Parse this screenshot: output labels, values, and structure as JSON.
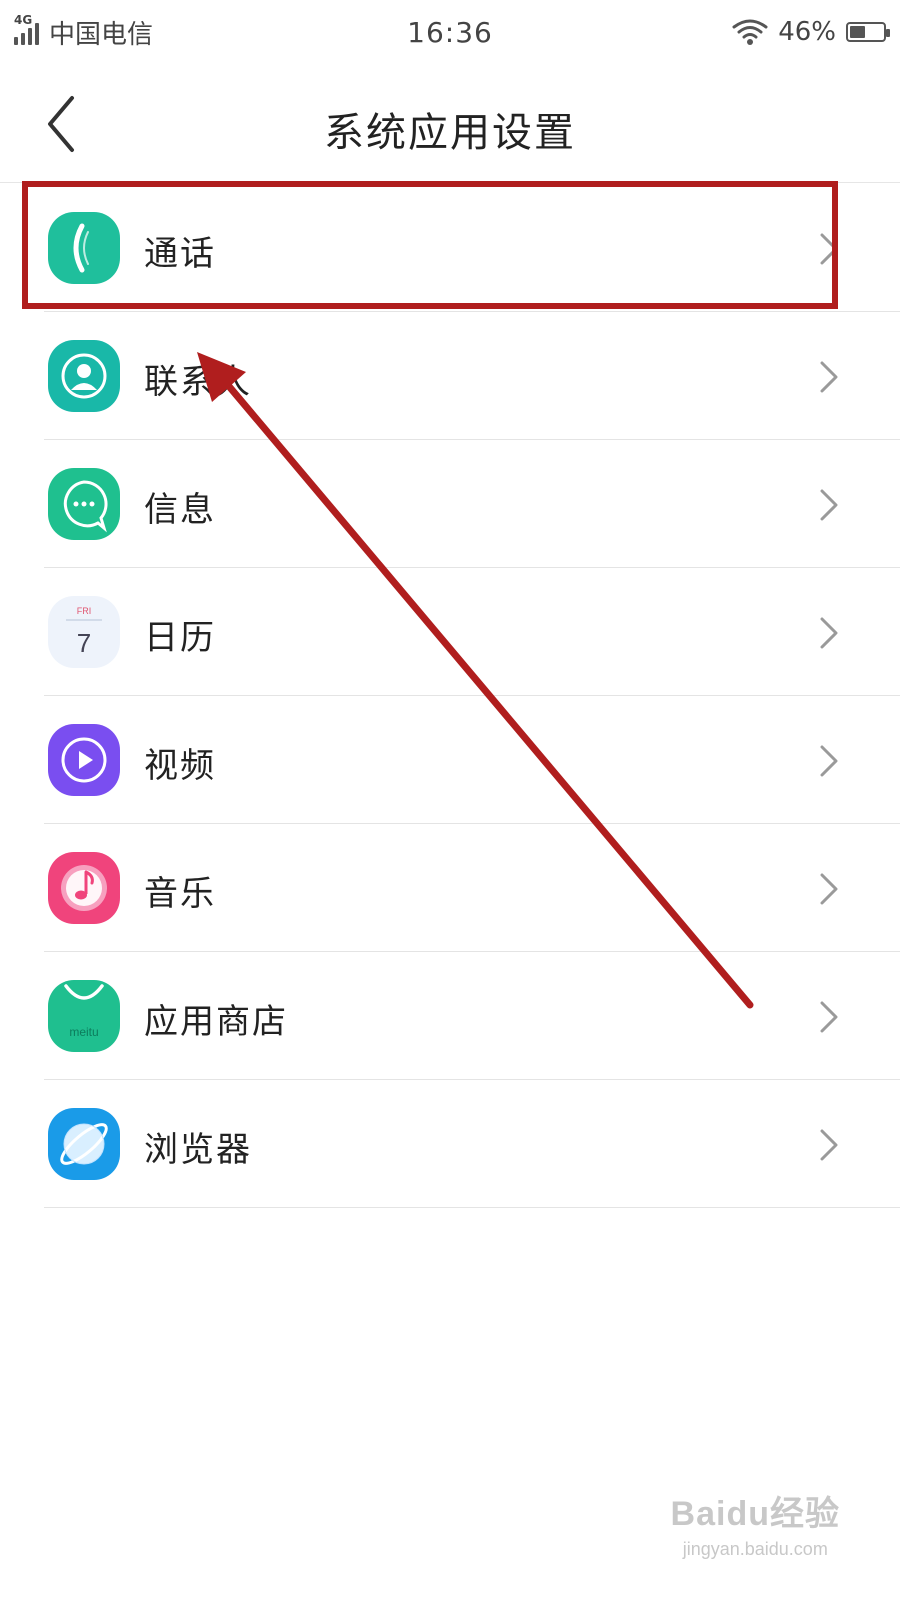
{
  "status_bar": {
    "network": "4G",
    "carrier": "中国电信",
    "time": "16:36",
    "battery_text": "46%",
    "battery_level": 0.46
  },
  "header": {
    "title": "系统应用设置",
    "back_icon": "chevron-left-icon"
  },
  "items": [
    {
      "label": "通话",
      "icon": "phone-icon",
      "color": "#1fbf9c"
    },
    {
      "label": "联系人",
      "icon": "contacts-icon",
      "color": "#19b8a8"
    },
    {
      "label": "信息",
      "icon": "message-icon",
      "color": "#1fc08f"
    },
    {
      "label": "日历",
      "icon": "calendar-icon",
      "color": "#eef3fb",
      "calendar_day": "FRI",
      "calendar_date": "7"
    },
    {
      "label": "视频",
      "icon": "video-icon",
      "color": "#7a4ef0"
    },
    {
      "label": "音乐",
      "icon": "music-icon",
      "color": "#f0447c"
    },
    {
      "label": "应用商店",
      "icon": "app-store-icon",
      "color": "#1fbf8f",
      "brand_text": "meitu"
    },
    {
      "label": "浏览器",
      "icon": "browser-icon",
      "color": "#1a9be8"
    }
  ],
  "annotation": {
    "color": "#b01e1e"
  },
  "watermark": {
    "main": "Baidu经验",
    "sub": "jingyan.baidu.com"
  }
}
